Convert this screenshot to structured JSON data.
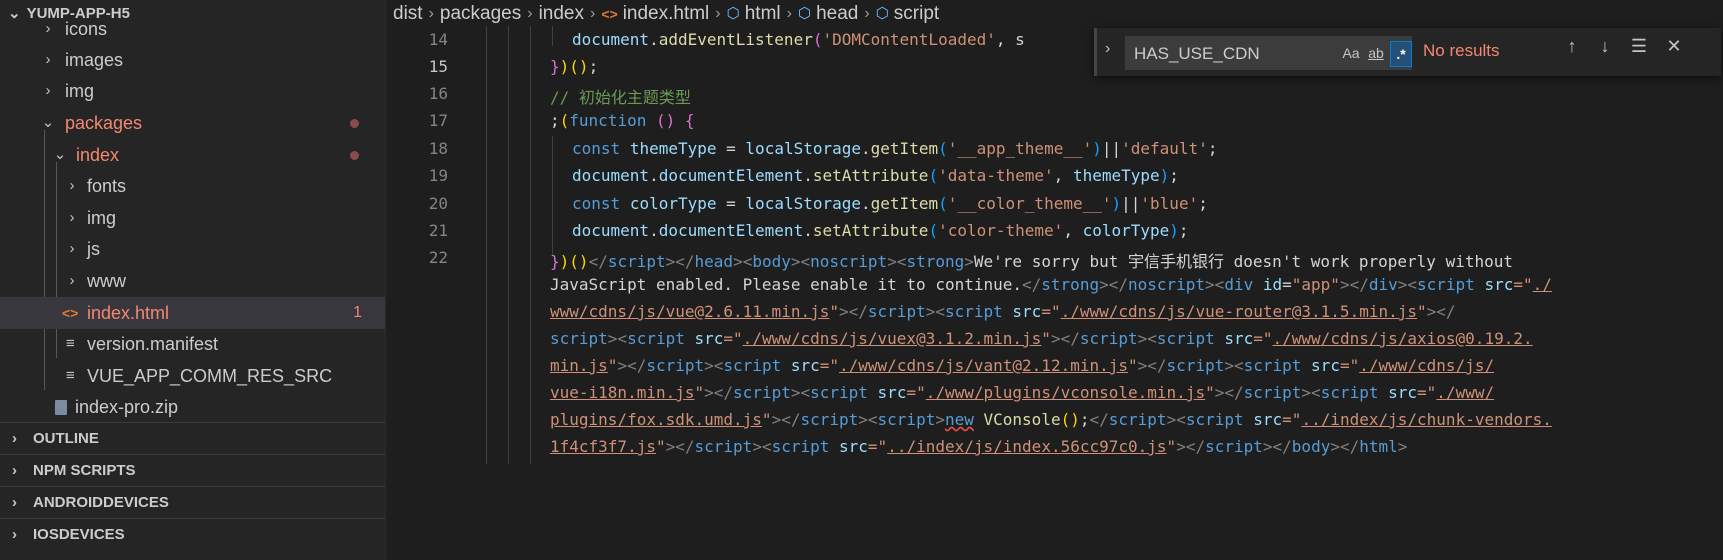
{
  "sidebar": {
    "title": "YUMP-APP-H5",
    "tree": [
      {
        "label": "icons"
      },
      {
        "label": "images"
      },
      {
        "label": "img"
      },
      {
        "label": "packages"
      },
      {
        "label": "index"
      },
      {
        "label": "fonts"
      },
      {
        "label": "img"
      },
      {
        "label": "js"
      },
      {
        "label": "www"
      },
      {
        "label": "index.html",
        "badge": "1"
      },
      {
        "label": "version.manifest"
      },
      {
        "label": "VUE_APP_COMM_RES_SRC"
      },
      {
        "label": "index-pro.zip"
      }
    ],
    "sections": [
      "OUTLINE",
      "NPM SCRIPTS",
      "ANDROIDDEVICES",
      "IOSDEVICES"
    ]
  },
  "breadcrumbs": [
    "dist",
    "packages",
    "index",
    "index.html",
    "html",
    "head",
    "script"
  ],
  "find": {
    "value": "HAS_USE_CDN",
    "match_case": "Aa",
    "whole_word": "ab",
    "regex": ".*",
    "result": "No results"
  },
  "editor": {
    "line_numbers": [
      "14",
      "15",
      "16",
      "17",
      "18",
      "19",
      "20",
      "21",
      "22"
    ],
    "active_line": "15",
    "lines": {
      "l14": [
        "document",
        ".",
        "addEventListener",
        "(",
        "'DOMContentLoaded'",
        ", s"
      ],
      "l15": [
        "}",
        ")",
        "(",
        ")",
        ";"
      ],
      "l16": "// 初始化主题类型",
      "l17": [
        ";",
        "(",
        "function",
        " ",
        "()",
        " ",
        "{"
      ],
      "l18": [
        "const",
        " ",
        "themeType",
        " = ",
        "localStorage",
        ".",
        "getItem",
        "(",
        "'__app_theme__'",
        ")",
        "||",
        "'default'",
        ";"
      ],
      "l19": [
        "document",
        ".",
        "documentElement",
        ".",
        "setAttribute",
        "(",
        "'data-theme'",
        ", ",
        "themeType",
        ")",
        ";"
      ],
      "l20": [
        "const",
        " ",
        "colorType",
        " = ",
        "localStorage",
        ".",
        "getItem",
        "(",
        "'__color_theme__'",
        ")",
        "||",
        "'blue'",
        ";"
      ],
      "l21": [
        "document",
        ".",
        "documentElement",
        ".",
        "setAttribute",
        "(",
        "'color-theme'",
        ", ",
        "colorType",
        ")",
        ";"
      ],
      "l22": {
        "r1": [
          "}",
          ")",
          "(",
          ")",
          "</",
          "script",
          "></",
          "head",
          "><",
          "body",
          "><",
          "noscript",
          "><",
          "strong",
          ">",
          "We're sorry but 宇信手机银行 doesn't work properly without"
        ],
        "r2": [
          "JavaScript enabled. Please enable it to continue.",
          "</",
          "strong",
          "></",
          "noscript",
          "><",
          "div",
          " ",
          "id",
          "=",
          "\"app\"",
          "></",
          "div",
          "><",
          "script",
          " ",
          "src",
          "=\"",
          "./"
        ],
        "r3": [
          "www/cdns/js/vue@2.6.11.min.js",
          "\"",
          "></",
          "script",
          "><",
          "script",
          " ",
          "src",
          "=\"",
          "./www/cdns/js/vue-router@3.1.5.min.js",
          "\"",
          "></"
        ],
        "r4": [
          "script",
          "><",
          "script",
          " ",
          "src",
          "=\"",
          "./www/cdns/js/vuex@3.1.2.min.js",
          "\"",
          "></",
          "script",
          "><",
          "script",
          " ",
          "src",
          "=\"",
          "./www/cdns/js/axios@0.19.2."
        ],
        "r5": [
          "min.js",
          "\"",
          "></",
          "script",
          "><",
          "script",
          " ",
          "src",
          "=\"",
          "./www/cdns/js/vant@2.12.min.js",
          "\"",
          "></",
          "script",
          "><",
          "script",
          " ",
          "src",
          "=\"",
          "./www/cdns/js/"
        ],
        "r6": [
          "vue-i18n.min.js",
          "\"",
          "></",
          "script",
          "><",
          "script",
          " ",
          "src",
          "=\"",
          "./www/plugins/vconsole.min.js",
          "\"",
          "></",
          "script",
          "><",
          "script",
          " ",
          "src",
          "=\"",
          "./www/"
        ],
        "r7": [
          "plugins/fox.sdk.umd.js",
          "\"",
          "></",
          "script",
          "><",
          "script",
          ">",
          "new",
          " ",
          "VConsole",
          "(",
          ")",
          ";",
          "</",
          "script",
          "><",
          "script",
          " ",
          "src",
          "=\"",
          "../index/js/chunk-vendors."
        ],
        "r8": [
          "1f4cf3f7.js",
          "\"",
          "></",
          "script",
          "><",
          "script",
          " ",
          "src",
          "=\"",
          "../index/js/index.56cc97c0.js",
          "\"",
          "></",
          "script",
          "></",
          "body",
          "></",
          "html",
          ">"
        ]
      }
    }
  }
}
